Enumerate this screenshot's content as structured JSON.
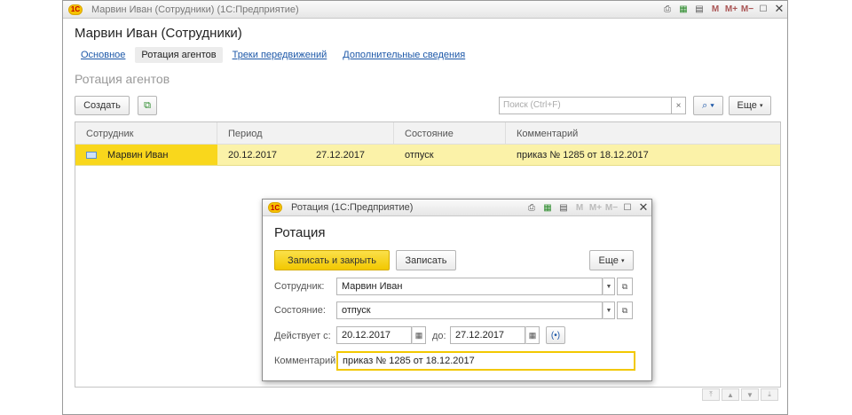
{
  "main_window": {
    "title": "Марвин Иван (Сотрудники)  (1С:Предприятие)",
    "logo": "1C",
    "header_title": "Марвин Иван (Сотрудники)",
    "tabs": [
      {
        "label": "Основное"
      },
      {
        "label": "Ротация агентов"
      },
      {
        "label": "Треки передвижений"
      },
      {
        "label": "Дополнительные сведения"
      }
    ],
    "section_title": "Ротация агентов",
    "toolbar": {
      "create_label": "Создать",
      "search_placeholder": "Поиск (Ctrl+F)",
      "clear_label": "×",
      "more_label": "Еще"
    },
    "table": {
      "columns": [
        "Сотрудник",
        "Период",
        "Состояние",
        "Комментарий"
      ],
      "rows": [
        {
          "employee": "Марвин Иван",
          "from": "20.12.2017",
          "to": "27.12.2017",
          "state": "отпуск",
          "comment": "приказ № 1285 от 18.12.2017"
        }
      ]
    },
    "window_buttons": {
      "m": "M",
      "m_plus": "M+",
      "m_minus": "M−"
    }
  },
  "dialog": {
    "title": "Ротация  (1С:Предприятие)",
    "logo": "1C",
    "heading": "Ротация",
    "save_close_label": "Записать и закрыть",
    "save_label": "Записать",
    "more_label": "Еще",
    "employee_label": "Сотрудник:",
    "employee_value": "Марвин Иван",
    "state_label": "Состояние:",
    "state_value": "отпуск",
    "valid_from_label": "Действует с:",
    "valid_from_value": "20.12.2017",
    "to_label": "до:",
    "to_value": "27.12.2017",
    "comment_label": "Комментарий:",
    "comment_value": "приказ № 1285 от 18.12.2017",
    "window_buttons": {
      "m": "M",
      "m_plus": "M+",
      "m_minus": "M−"
    }
  },
  "colors": {
    "accent_yellow": "#f9d71c",
    "selected_row": "#fbf2a8",
    "link": "#1d58a8"
  }
}
